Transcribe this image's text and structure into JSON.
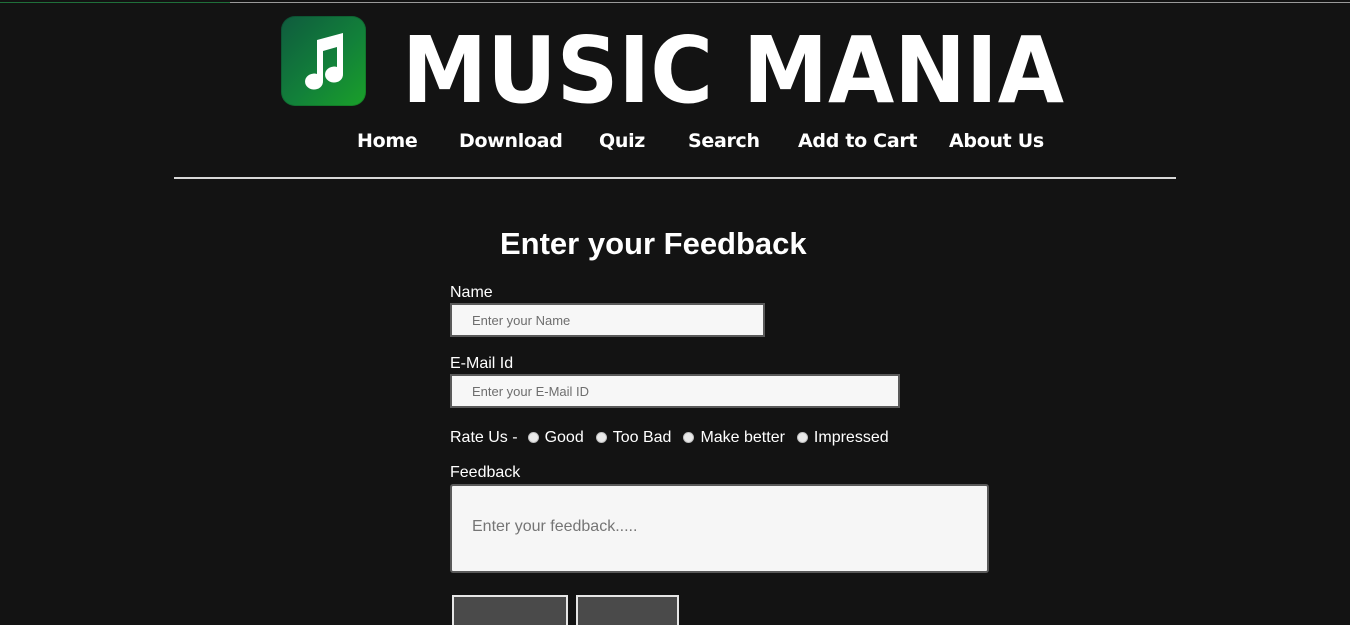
{
  "brand": {
    "name": "MUSIC MANIA",
    "logo_icon": "music-note-icon",
    "logo_gradient": [
      "#0f5b3e",
      "#1aa029"
    ]
  },
  "nav": {
    "items": [
      {
        "label": "Home"
      },
      {
        "label": "Download"
      },
      {
        "label": "Quiz"
      },
      {
        "label": "Search"
      },
      {
        "label": "Add to Cart"
      },
      {
        "label": "About Us"
      }
    ]
  },
  "form": {
    "title": "Enter your Feedback",
    "name_label": "Name",
    "name_placeholder": "Enter your Name",
    "email_label": "E-Mail Id",
    "email_placeholder": "Enter your E-Mail ID",
    "rate_label": "Rate Us -",
    "rate_options": [
      {
        "label": "Good",
        "checked": false
      },
      {
        "label": "Too Bad",
        "checked": false
      },
      {
        "label": "Make better",
        "checked": false
      },
      {
        "label": "Impressed",
        "checked": false
      }
    ],
    "feedback_label": "Feedback",
    "feedback_placeholder": "Enter your feedback....."
  },
  "colors": {
    "background": "#131313",
    "text": "#ffffff",
    "input_bg": "#f7f7f7"
  }
}
